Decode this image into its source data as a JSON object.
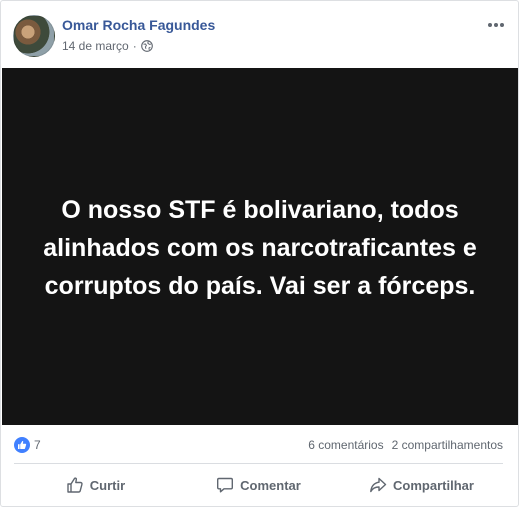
{
  "post": {
    "author": "Omar Rocha Fagundes",
    "date": "14 de março",
    "separator": "·",
    "privacy_icon": "globe-icon",
    "image_text": "O nosso STF é bolivariano, todos alinhados com os narcotraficantes e corruptos do país. Vai ser a fórceps."
  },
  "stats": {
    "reactions": "7",
    "comments": "6 comentários",
    "shares": "2 compartilhamentos"
  },
  "actions": {
    "like": "Curtir",
    "comment": "Comentar",
    "share": "Compartilhar"
  },
  "colors": {
    "link": "#385898",
    "like_badge": "#4080ff",
    "image_bg": "#141414"
  }
}
